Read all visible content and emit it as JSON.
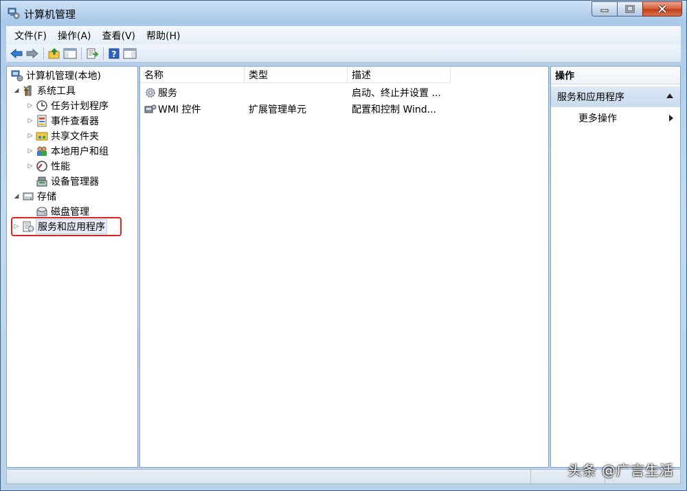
{
  "window": {
    "title": "计算机管理",
    "controls": {
      "minimize": "minimize-icon",
      "maximize": "maximize-icon",
      "close": "close-icon"
    }
  },
  "menu": [
    "文件(F)",
    "操作(A)",
    "查看(V)",
    "帮助(H)"
  ],
  "toolbar": {
    "icons": [
      "back-arrow-icon",
      "forward-arrow-icon",
      "up-folder-icon",
      "show-tree-icon",
      "export-list-icon",
      "help-icon",
      "console-icon"
    ]
  },
  "tree": {
    "items": [
      {
        "label": "计算机管理(本地)",
        "icon": "computer-management-icon",
        "level": 0,
        "arrow": ""
      },
      {
        "label": "系统工具",
        "icon": "tools-icon",
        "level": 1,
        "arrow": "◢"
      },
      {
        "label": "任务计划程序",
        "icon": "clock-icon",
        "level": 2,
        "arrow": "▷"
      },
      {
        "label": "事件查看器",
        "icon": "event-viewer-icon",
        "level": 2,
        "arrow": "▷"
      },
      {
        "label": "共享文件夹",
        "icon": "shared-folder-icon",
        "level": 2,
        "arrow": "▷"
      },
      {
        "label": "本地用户和组",
        "icon": "users-icon",
        "level": 2,
        "arrow": "▷"
      },
      {
        "label": "性能",
        "icon": "performance-icon",
        "level": 2,
        "arrow": "▷"
      },
      {
        "label": "设备管理器",
        "icon": "device-manager-icon",
        "level": 2,
        "arrow": ""
      },
      {
        "label": "存储",
        "icon": "storage-icon",
        "level": 1,
        "arrow": "◢"
      },
      {
        "label": "磁盘管理",
        "icon": "disk-icon",
        "level": 2,
        "arrow": ""
      },
      {
        "label": "服务和应用程序",
        "icon": "services-apps-icon",
        "level": 1,
        "arrow": "▷",
        "selected": true
      }
    ]
  },
  "list": {
    "columns": [
      "名称",
      "类型",
      "描述"
    ],
    "rows": [
      {
        "name": "服务",
        "type": "",
        "desc": "启动、终止并设置 ...",
        "icon": "gear-icon"
      },
      {
        "name": "WMI 控件",
        "type": "扩展管理单元",
        "desc": "配置和控制 Wind...",
        "icon": "wmi-icon"
      }
    ]
  },
  "actions": {
    "title": "操作",
    "section": "服务和应用程序",
    "items": [
      "更多操作"
    ]
  },
  "watermark": "头条 @广言生活",
  "colors": {
    "highlight": "#e02020",
    "accent": "#c9dbee"
  }
}
